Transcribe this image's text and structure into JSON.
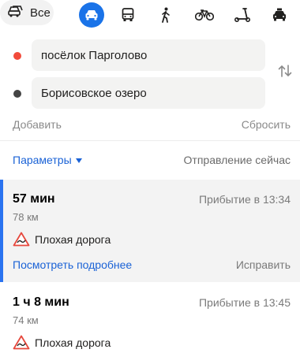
{
  "modes": {
    "all_label": "Все",
    "active_color": "#1a73e8",
    "items": [
      "car-icon",
      "bus-icon",
      "walk-icon",
      "bike-icon",
      "scooter-icon",
      "taxi-icon"
    ]
  },
  "route": {
    "from": "посёлок Парголово",
    "to": "Борисовское озеро",
    "from_color": "#f24b3b",
    "to_color": "#444444"
  },
  "actions": {
    "add": "Добавить",
    "reset": "Сбросить"
  },
  "options": {
    "params_label": "Параметры",
    "departure": "Отправление сейчас"
  },
  "routes": [
    {
      "time": "57 мин",
      "arrival": "Прибытие в 13:34",
      "distance": "78 км",
      "warning": "Плохая дорога",
      "details_link": "Посмотреть подробнее",
      "fix_link": "Исправить"
    },
    {
      "time": "1 ч 8 мин",
      "arrival": "Прибытие в 13:45",
      "distance": "74 км",
      "warning": "Плохая дорога"
    }
  ]
}
